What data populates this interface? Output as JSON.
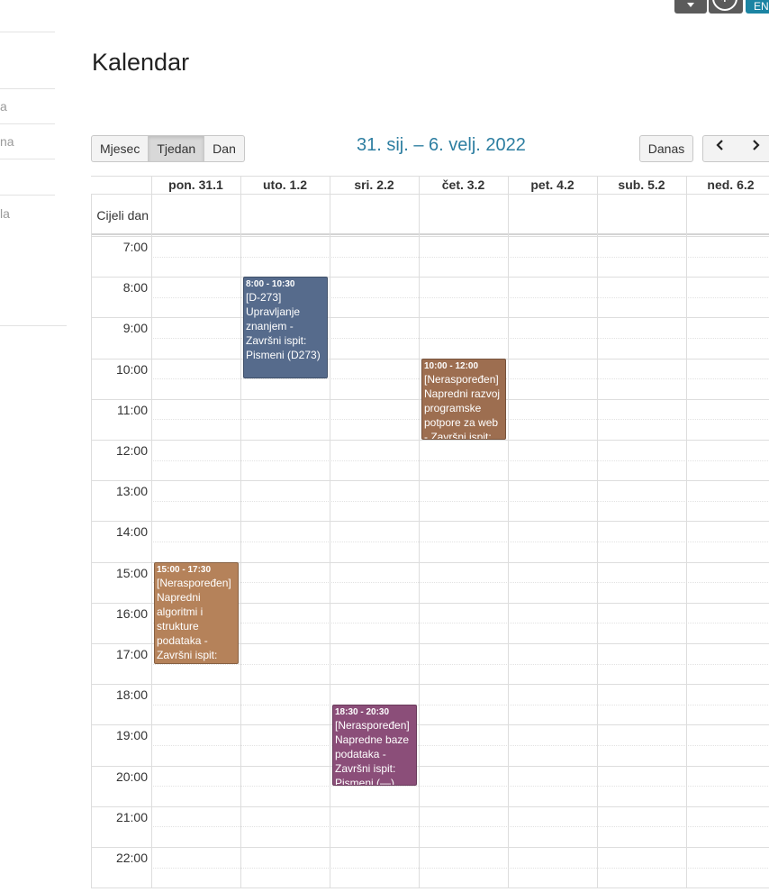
{
  "topbar": {
    "accessibility_icon": "accessibility-icon",
    "lang_label": "EN"
  },
  "sidebar": {
    "fragments": [
      "a",
      "na",
      "la"
    ]
  },
  "page": {
    "title": "Kalendar"
  },
  "toolbar": {
    "views": [
      {
        "label": "Mjesec",
        "active": false
      },
      {
        "label": "Tjedan",
        "active": true
      },
      {
        "label": "Dan",
        "active": false
      }
    ],
    "range_title": "31. sij. – 6. velj. 2022",
    "today_label": "Danas",
    "prev_icon": "chevron-left-icon",
    "next_icon": "chevron-right-icon"
  },
  "calendar": {
    "allday_label": "Cijeli dan",
    "days": [
      "pon. 31.1",
      "uto. 1.2",
      "sri. 2.2",
      "čet. 3.2",
      "pet. 4.2",
      "sub. 5.2",
      "ned. 6.2"
    ],
    "hours": [
      "7:00",
      "8:00",
      "9:00",
      "10:00",
      "11:00",
      "12:00",
      "13:00",
      "14:00",
      "15:00",
      "16:00",
      "17:00",
      "18:00",
      "19:00",
      "20:00",
      "21:00",
      "22:00"
    ],
    "events": [
      {
        "day": 1,
        "start": 8.0,
        "end": 10.5,
        "time": "8:00 - 10:30",
        "title": "[D-273] Upravljanje znanjem - Završni ispit: Pismeni (D273)",
        "color": "#566b8c"
      },
      {
        "day": 3,
        "start": 10.0,
        "end": 12.0,
        "time": "10:00 - 12:00",
        "title": "[Neraspoređen] Napredni razvoj programske potpore za web - Završni ispit:",
        "color": "#9d6e50"
      },
      {
        "day": 0,
        "start": 15.0,
        "end": 17.5,
        "time": "15:00 - 17:30",
        "title": "[Neraspoređen] Napredni algoritmi i strukture podataka - Završni ispit:",
        "color": "#b5825a"
      },
      {
        "day": 2,
        "start": 18.5,
        "end": 20.5,
        "time": "18:30 - 20:30",
        "title": "[Neraspoređen] Napredne baze podataka - Završni ispit: Pismeni (—)",
        "color": "#8b4e79"
      }
    ]
  }
}
